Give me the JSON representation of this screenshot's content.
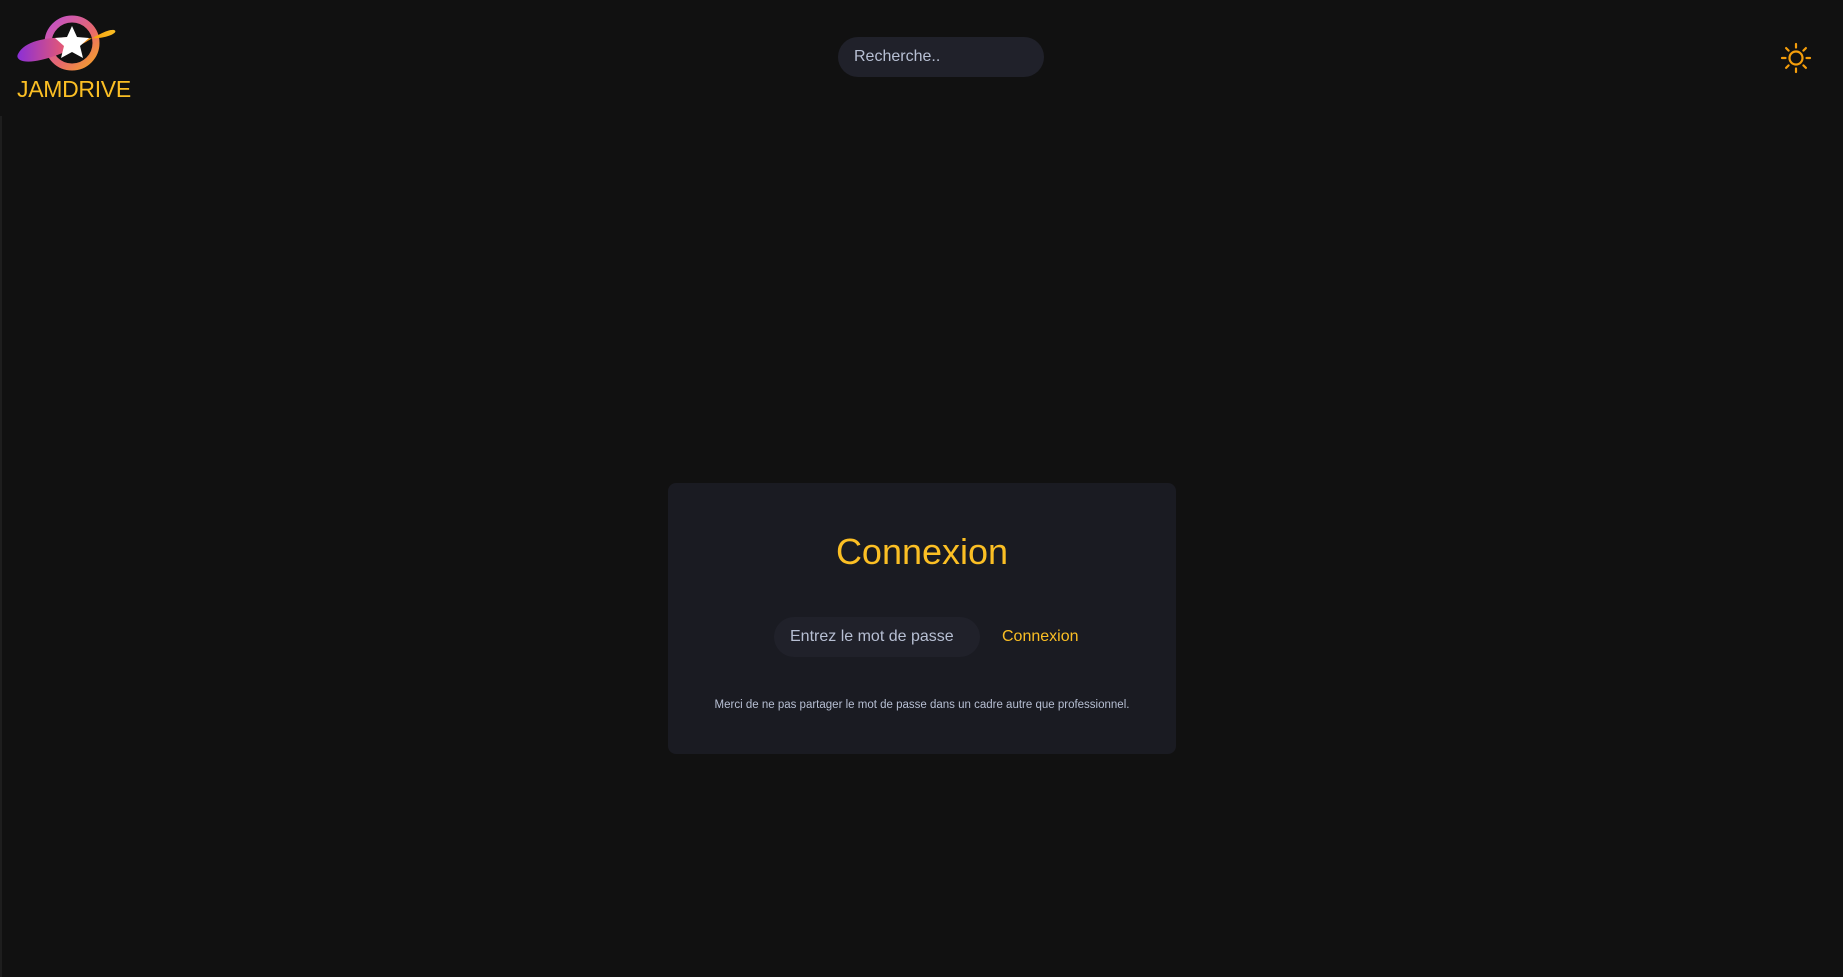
{
  "colors": {
    "background": "#111111",
    "surface": "#1a1b22",
    "input_bg": "#20212a",
    "accent": "#fbbf24",
    "accent_orange": "#f59e0b",
    "text_muted": "#b7bfd3",
    "logo_purple": "#9b3bd6",
    "logo_pink": "#e0567a"
  },
  "header": {
    "brand": "JAMDRIVE",
    "logo_icon": "planet-star-logo-icon",
    "search_placeholder": "Recherche..",
    "theme_icon": "sun-icon"
  },
  "login": {
    "title": "Connexion",
    "password_placeholder": "Entrez le mot de passe",
    "button_label": "Connexion",
    "notice": "Merci de ne pas partager le mot de passe dans un cadre autre que professionnel."
  }
}
